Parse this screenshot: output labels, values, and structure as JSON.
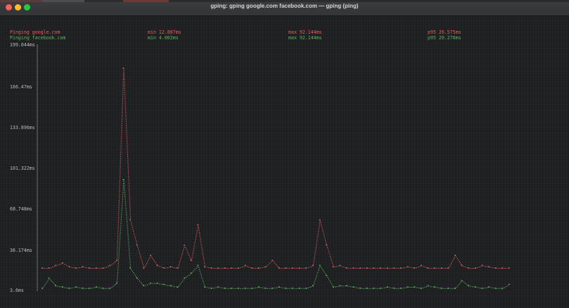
{
  "window": {
    "title": "gping: gping google.com facebook.com — gping (ping)",
    "traffic_lights": [
      "close",
      "minimize",
      "zoom"
    ],
    "colors": {
      "close": "#ff5f57",
      "minimize": "#febc2e",
      "zoom": "#28c840"
    }
  },
  "hosts": [
    {
      "label": "Pinging google.com",
      "min": "min 12.887ms",
      "max": "max 92.144ms",
      "p95": "p95 26.575ms",
      "color": "#e0625a"
    },
    {
      "label": "Pinging facebook.com",
      "min": "min 4.002ms",
      "max": "max 92.144ms",
      "p95": "p95 20.278ms",
      "color": "#61b35f"
    }
  ],
  "chart_data": {
    "type": "line",
    "xlabel": "",
    "ylabel": "",
    "y_ticks": [
      "199.044ms",
      "166.47ms",
      "133.896ms",
      "101.322ms",
      "68.748ms",
      "36.174ms",
      "3.6ms"
    ],
    "ylim": [
      3.6,
      199.044
    ],
    "x": [
      0,
      1,
      2,
      3,
      4,
      5,
      6,
      7,
      8,
      9,
      10,
      11,
      12,
      13,
      14,
      15,
      16,
      17,
      18,
      19,
      20,
      21,
      22,
      23,
      24,
      25,
      26,
      27,
      28,
      29,
      30,
      31,
      32,
      33,
      34,
      35,
      36,
      37,
      38,
      39,
      40,
      41,
      42,
      43,
      44,
      45,
      46,
      47,
      48,
      49,
      50,
      51,
      52,
      53,
      54,
      55,
      56,
      57,
      58,
      59,
      60,
      61,
      62,
      63,
      64,
      65,
      66,
      67,
      68,
      69
    ],
    "series": [
      {
        "name": "google.com",
        "color": "#e0625a",
        "values": [
          22,
          22,
          24,
          26,
          23,
          22,
          23,
          22,
          22,
          22,
          24,
          28,
          180,
          60,
          40,
          22,
          32,
          24,
          22,
          23,
          22,
          40,
          28,
          56,
          23,
          22,
          22,
          22,
          22,
          22,
          24,
          22,
          22,
          23,
          28,
          22,
          22,
          22,
          22,
          22,
          24,
          60,
          40,
          23,
          24,
          22,
          22,
          22,
          22,
          22,
          22,
          22,
          22,
          22,
          23,
          22,
          24,
          22,
          22,
          22,
          22,
          32,
          24,
          22,
          22,
          24,
          23,
          22,
          22,
          22
        ]
      },
      {
        "name": "facebook.com",
        "color": "#61b35f",
        "values": [
          6,
          14,
          8,
          7,
          6,
          7,
          6,
          6,
          7,
          6,
          6,
          10,
          92,
          22,
          14,
          8,
          10,
          10,
          9,
          8,
          7,
          14,
          18,
          24,
          7,
          6,
          7,
          6,
          6,
          6,
          6,
          6,
          7,
          6,
          6,
          7,
          6,
          6,
          6,
          6,
          8,
          24,
          16,
          7,
          8,
          8,
          7,
          6,
          6,
          6,
          6,
          7,
          6,
          6,
          7,
          7,
          6,
          8,
          7,
          6,
          6,
          6,
          12,
          8,
          7,
          6,
          7,
          6,
          6,
          9
        ]
      }
    ]
  }
}
